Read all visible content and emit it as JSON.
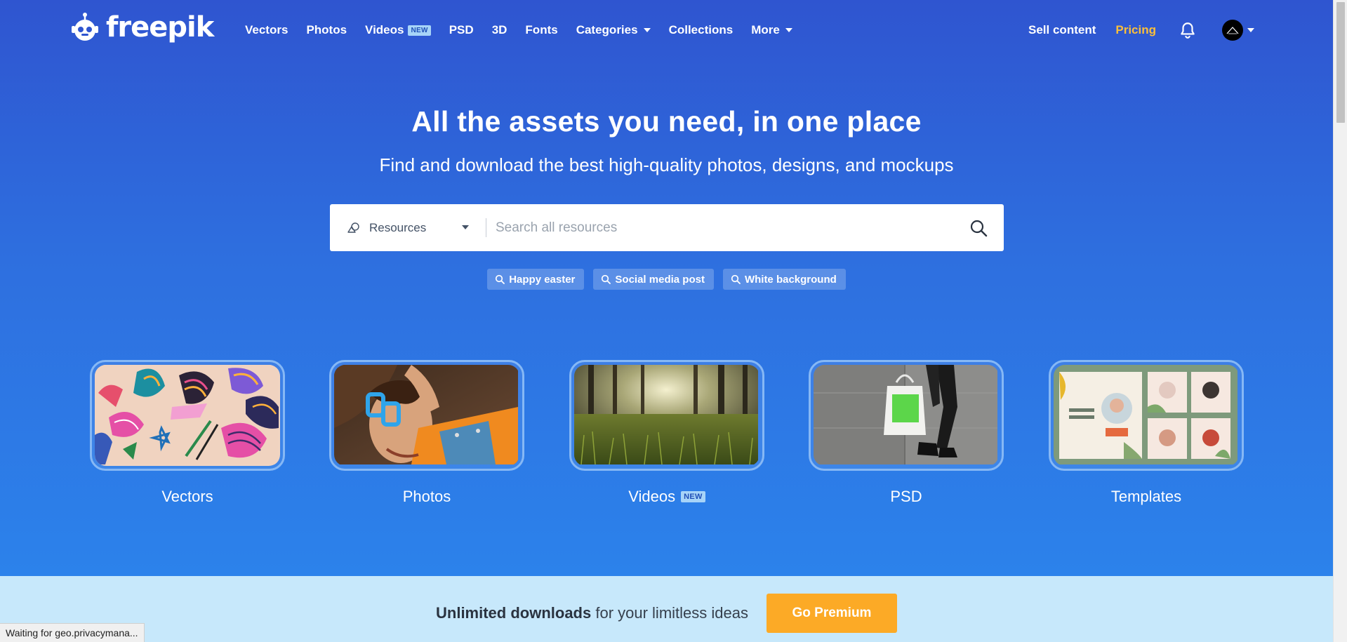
{
  "nav": {
    "logo_text": "freepik",
    "links": [
      {
        "label": "Vectors"
      },
      {
        "label": "Photos"
      },
      {
        "label": "Videos",
        "badge": "NEW"
      },
      {
        "label": "PSD"
      },
      {
        "label": "3D"
      },
      {
        "label": "Fonts"
      },
      {
        "label": "Categories",
        "dropdown": true
      },
      {
        "label": "Collections"
      },
      {
        "label": "More",
        "dropdown": true
      }
    ],
    "sell_content": "Sell content",
    "pricing": "Pricing",
    "icons": {
      "bell": "bell-icon",
      "avatar": "user-avatar"
    }
  },
  "hero": {
    "headline": "All the assets you need, in one place",
    "subhead": "Find and download the best high-quality photos, designs, and mockups"
  },
  "search": {
    "type_label": "Resources",
    "placeholder": "Search all resources"
  },
  "suggestions": [
    "Happy easter",
    "Social media post",
    "White background"
  ],
  "categories": [
    {
      "label": "Vectors"
    },
    {
      "label": "Photos"
    },
    {
      "label": "Videos",
      "badge": "NEW"
    },
    {
      "label": "PSD"
    },
    {
      "label": "Templates"
    }
  ],
  "premium": {
    "bold": "Unlimited downloads",
    "rest": " for your limitless ideas",
    "button": "Go Premium"
  },
  "status_bar": "Waiting for geo.privacymana...",
  "colors": {
    "hero_top": "#2f55d0",
    "hero_bottom": "#2c82eb",
    "pricing": "#fbbf3a",
    "premium_button": "#fcaa26",
    "premium_band": "#c7e8fb"
  }
}
